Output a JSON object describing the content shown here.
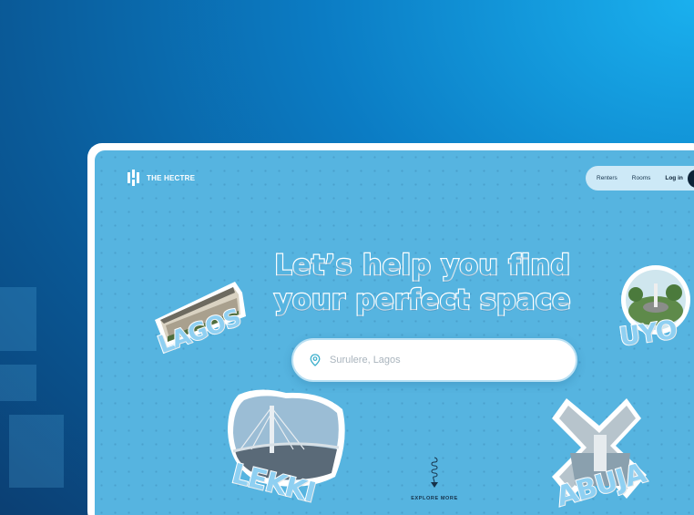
{
  "brand": {
    "name": "THE HECTRE"
  },
  "nav": {
    "items": [
      "Renters",
      "Rooms"
    ],
    "login_label": "Log in"
  },
  "hero": {
    "headline_line1": "Let’s help you find",
    "headline_line2": "your perfect space"
  },
  "search": {
    "placeholder": "Surulere, Lagos",
    "icon": "map-pin-icon"
  },
  "stickers": {
    "lagos": "LAGOS",
    "uyo": "UYO",
    "lekki": "LEKKI",
    "abuja": "ABUJA"
  },
  "explore": {
    "label": "EXPLORE MORE",
    "icon": "spiral-arrow-icon"
  },
  "colors": {
    "hero_bg": "#56b4e0",
    "outer_bg": "#0a5a98",
    "nav_pill": "#cde9f7",
    "dark": "#0d2338"
  }
}
